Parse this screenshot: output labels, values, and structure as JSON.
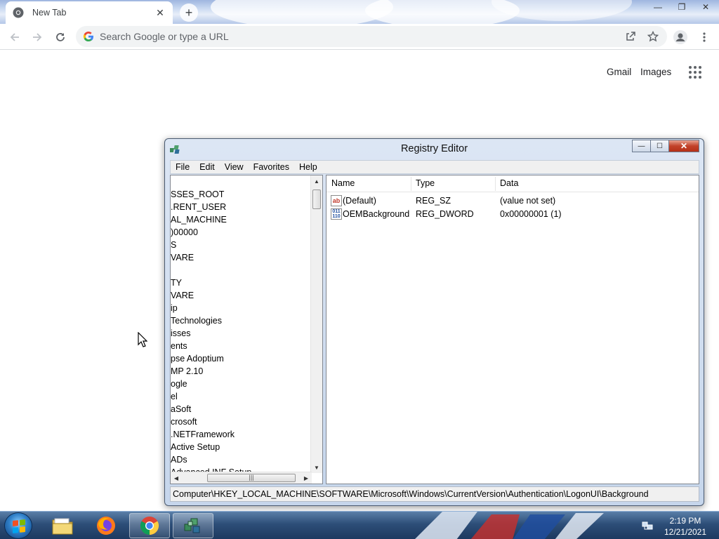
{
  "browser": {
    "tab_title": "New Tab",
    "tab_close": "✕",
    "new_tab_label": "+",
    "window_controls": {
      "minimize": "—",
      "restore": "❐",
      "close": "✕"
    },
    "omnibox_placeholder": "Search Google or type a URL"
  },
  "ntp": {
    "gmail_label": "Gmail",
    "images_label": "Images"
  },
  "regedit": {
    "title": "Registry Editor",
    "controls": {
      "minimize": "—",
      "maximize": "☐",
      "close": "✕"
    },
    "menu": [
      "File",
      "Edit",
      "View",
      "Favorites",
      "Help"
    ],
    "tree_items": [
      "SSES_ROOT",
      ".RENT_USER",
      "AL_MACHINE",
      ")00000",
      "S",
      "VARE",
      "",
      "TY",
      "VARE",
      "ip",
      " Technologies",
      "isses",
      "ents",
      "pse Adoptium",
      "MP 2.10",
      "ogle",
      "el",
      "aSoft",
      "crosoft",
      ".NETFramework",
      "Active Setup",
      "ADs",
      "Advanced INF Setup"
    ],
    "hscroll_grip": "|||",
    "columns": [
      "Name",
      "Type",
      "Data"
    ],
    "values": [
      {
        "icon": "ab",
        "name": "(Default)",
        "type": "REG_SZ",
        "data": "(value not set)"
      },
      {
        "icon": "011\n110",
        "name": "OEMBackground",
        "type": "REG_DWORD",
        "data": "0x00000001 (1)"
      }
    ],
    "status_path": "Computer\\HKEY_LOCAL_MACHINE\\SOFTWARE\\Microsoft\\Windows\\CurrentVersion\\Authentication\\LogonUI\\Background"
  },
  "taskbar": {
    "time": "2:19 PM",
    "date": "12/21/2021"
  },
  "colors": {
    "chrome_accent": "#1a73e8",
    "taskbar": "#2d4e78",
    "close_red": "#c2422a"
  }
}
